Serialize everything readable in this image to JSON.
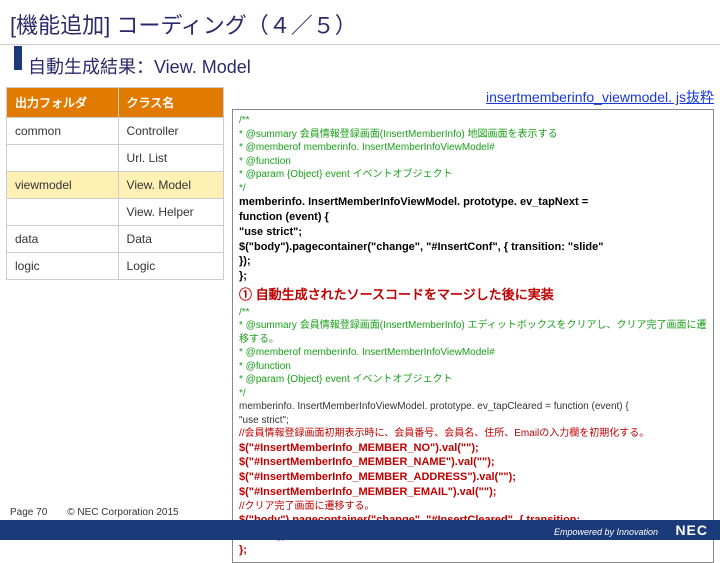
{
  "title": "[機能追加] コーディング（４／５）",
  "subtitle": "自動生成結果：View. Model",
  "table": {
    "headers": [
      "出力フォルダ",
      "クラス名"
    ],
    "rows": [
      {
        "folder": "common",
        "cls": "Controller",
        "hl": false
      },
      {
        "folder": "",
        "cls": "Url. List",
        "hl": false
      },
      {
        "folder": "viewmodel",
        "cls": "View. Model",
        "hl": true
      },
      {
        "folder": "",
        "cls": "View. Helper",
        "hl": false
      },
      {
        "folder": "data",
        "cls": "Data",
        "hl": false
      },
      {
        "folder": "logic",
        "cls": "Logic",
        "hl": false
      }
    ]
  },
  "filename": "insertmemberinfo_viewmodel. js抜粋",
  "code": {
    "c1": "/**",
    "c2": " * @summary 会員情報登録画面(InsertMemberInfo) 地図画面を表示する",
    "c3": " * @memberof memberinfo. InsertMemberInfoViewModel#",
    "c4": " * @function",
    "c5": " * @param {Object} event イベントオブジェクト",
    "c6": " */",
    "b1": "memberinfo. InsertMemberInfoViewModel. prototype. ev_tapNext =",
    "b2": "function (event) {",
    "b3": "    \"use strict\";",
    "b4": "    $(\"body\").pagecontainer(\"change\", \"#InsertConf\", { transition: \"slide\"",
    "b5": "});",
    "b6": "};",
    "annot1": "① 自動生成されたソースコードをマージした後に実装",
    "d1": "/**",
    "d2": " * @summary 会員情報登録画面(InsertMemberInfo) エディットボックスをクリアし、クリア完了画面に遷移する。",
    "d3": " * @memberof memberinfo. InsertMemberInfoViewModel#",
    "d4": " * @function",
    "d5": " * @param {Object} event イベントオブジェクト",
    "d6": " */",
    "e1": "memberinfo. InsertMemberInfoViewModel. prototype. ev_tapCleared = function (event) {",
    "e2": "  \"use strict\";",
    "e3": "//会員情報登録画面初期表示時に、会員番号、会員名、住所、Emailの入力欄を初期化する。",
    "r1": "$(\"#InsertMemberInfo_MEMBER_NO\").val(\"\");",
    "r2": "$(\"#InsertMemberInfo_MEMBER_NAME\").val(\"\");",
    "r3": "$(\"#InsertMemberInfo_MEMBER_ADDRESS\").val(\"\");",
    "r4": "$(\"#InsertMemberInfo_MEMBER_EMAIL\").val(\"\");",
    "e4": "//クリア完了画面に遷移する。",
    "r5": "$(\"body\").pagecontainer(\"change\", \"#InsertCleared\", { transition:",
    "r6": "\"slide\" }) ;",
    "r7": "};"
  },
  "footer": {
    "page": "Page 70",
    "copyright": "© NEC Corporation 2015",
    "tagline": "Empowered by Innovation",
    "logo": "NEC"
  }
}
